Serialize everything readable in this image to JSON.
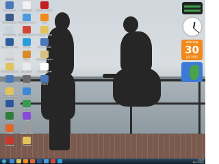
{
  "desktop_icons": [
    {
      "label": "Computer",
      "icon": "computer-icon",
      "color": "#4a78b8"
    },
    {
      "label": "Bureaublad",
      "icon": "desktop-icon",
      "color": "#3a5a8a"
    },
    {
      "label": "Prullenbak",
      "icon": "recycle-bin-icon",
      "color": "#c8d2dc"
    },
    {
      "label": "Studio 100 Radio",
      "icon": "radio-icon",
      "color": "#2e5d9e"
    },
    {
      "label": "AWLOG",
      "icon": "app-icon",
      "color": "#d8d8d8"
    },
    {
      "label": "Mijn documenten",
      "icon": "folder-icon",
      "color": "#e2c25a"
    },
    {
      "label": "Netwerk",
      "icon": "network-icon",
      "color": "#4a78b8"
    },
    {
      "label": "Mijn afbeeldingen",
      "icon": "pictures-folder-icon",
      "color": "#e2c25a"
    },
    {
      "label": "Word",
      "icon": "word-icon",
      "color": "#2b579a"
    },
    {
      "label": "Excel",
      "icon": "excel-icon",
      "color": "#2f7d3a"
    },
    {
      "label": "Firefox",
      "icon": "firefox-icon",
      "color": "#e0672a"
    },
    {
      "label": "Outlook",
      "icon": "outlook-icon",
      "color": "#c9362c"
    },
    {
      "label": "Notepad",
      "icon": "notepad-icon",
      "color": "#f2f2f2"
    },
    {
      "label": "Windows Live Mail",
      "icon": "mail-icon",
      "color": "#4a9be0"
    },
    {
      "label": "Google Chrome",
      "icon": "chrome-icon",
      "color": "#d24534"
    },
    {
      "label": "Skype",
      "icon": "skype-icon",
      "color": "#2a9de0"
    },
    {
      "label": "Paint",
      "icon": "paint-icon",
      "color": "#d88a2a"
    },
    {
      "label": "Kladblok",
      "icon": "notepad-icon",
      "color": "#e9e9e9"
    },
    {
      "label": "Afdrukken",
      "icon": "printer-icon",
      "color": "#6a6a6a"
    },
    {
      "label": "Internet",
      "icon": "globe-icon",
      "color": "#3a8ad8"
    },
    {
      "label": "Muziek",
      "icon": "music-icon",
      "color": "#3a9a52"
    },
    {
      "label": "Video",
      "icon": "video-icon",
      "color": "#8a4ad8"
    },
    {
      "label": "Instellingen",
      "icon": "settings-icon",
      "color": "#9a9a9a"
    },
    {
      "label": "Games",
      "icon": "games-icon",
      "color": "#e2c25a"
    }
  ],
  "second_column": [
    {
      "label": "Adobe Reader",
      "icon": "pdf-icon",
      "color": "#c21f1f"
    },
    {
      "label": "VLC",
      "icon": "vlc-icon",
      "color": "#f08a1c"
    },
    {
      "label": "Nieuwe map",
      "icon": "folder-icon",
      "color": "#e2c25a"
    },
    {
      "label": "Downloads",
      "icon": "downloads-icon",
      "color": "#4a78b8"
    },
    {
      "label": "Afbeeldingen",
      "icon": "pictures-folder-icon",
      "color": "#d8c080"
    },
    {
      "label": "Nieuwsbrief",
      "icon": "document-icon",
      "color": "#ffffff"
    },
    {
      "label": "Foto's",
      "icon": "photo-icon",
      "color": "#4a78b8"
    }
  ],
  "gadgets": {
    "calendar": {
      "day_number": "30",
      "day_name": "zaterdag",
      "month": "juli 2011"
    },
    "meter_colors": [
      "#3fa34d",
      "#3fa34d"
    ]
  },
  "taskbar": {
    "tray_time": "13:22",
    "tray_date": "30-7-2011",
    "pinned": [
      {
        "icon": "ie-icon",
        "color": "#3a8ad8"
      },
      {
        "icon": "explorer-icon",
        "color": "#e2c25a"
      },
      {
        "icon": "media-player-icon",
        "color": "#f08a1c"
      },
      {
        "icon": "firefox-icon",
        "color": "#e0672a"
      },
      {
        "icon": "word-icon",
        "color": "#2b579a"
      },
      {
        "icon": "mail-icon",
        "color": "#4a9be0"
      },
      {
        "icon": "chrome-icon",
        "color": "#d24534"
      },
      {
        "icon": "skype-icon",
        "color": "#2a9de0"
      }
    ]
  }
}
